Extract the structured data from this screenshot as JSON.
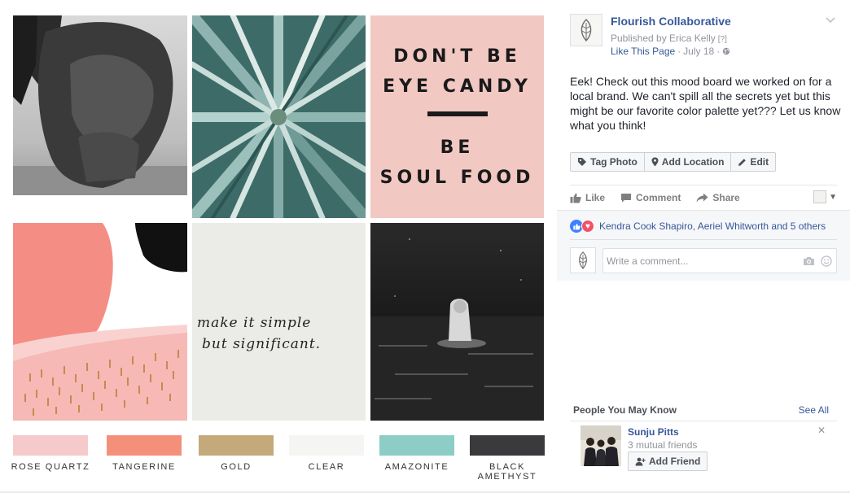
{
  "board": {
    "poster_lines": [
      "DON'T BE",
      "EYE CANDY",
      "BE",
      "SOUL FOOD"
    ],
    "handwriting": [
      "make it simple",
      "but significant."
    ],
    "swatches": [
      {
        "label": "ROSE QUARTZ",
        "color": "#f6cacb"
      },
      {
        "label": "TANGERINE",
        "color": "#f4907a"
      },
      {
        "label": "GOLD",
        "color": "#c4a97b"
      },
      {
        "label": "CLEAR",
        "color": "#f5f5f4"
      },
      {
        "label": "AMAZONITE",
        "color": "#8ccdc6"
      },
      {
        "label": "BLACK AMETHYST",
        "color": "#3a3a3c",
        "lines": [
          "BLACK",
          "AMETHYST"
        ]
      }
    ]
  },
  "post": {
    "page_name": "Flourish Collaborative",
    "published_by": "Published by Erica Kelly",
    "help_mark": "[?]",
    "like_page": "Like This Page",
    "date": "July 18",
    "text": "Eek! Check out this mood board we worked on for a local brand. We can't spill all the secrets yet but this might be our favorite color palette yet??? Let us know what you think!",
    "photo_actions": {
      "tag": "Tag Photo",
      "location": "Add Location",
      "edit": "Edit"
    },
    "actions": {
      "like": "Like",
      "comment": "Comment",
      "share": "Share"
    },
    "likers": "Kendra Cook Shapiro, Aeriel Whitworth and 5 others",
    "comment_placeholder": "Write a comment..."
  },
  "pymk": {
    "title": "People You May Know",
    "see_all": "See All",
    "friend": {
      "name": "Sunju Pitts",
      "mutual": "3 mutual friends",
      "add_label": "Add Friend"
    }
  },
  "colors": {
    "link": "#365899",
    "meta": "#90949c",
    "like_blue": "#4080ff",
    "love_red": "#f25268"
  }
}
